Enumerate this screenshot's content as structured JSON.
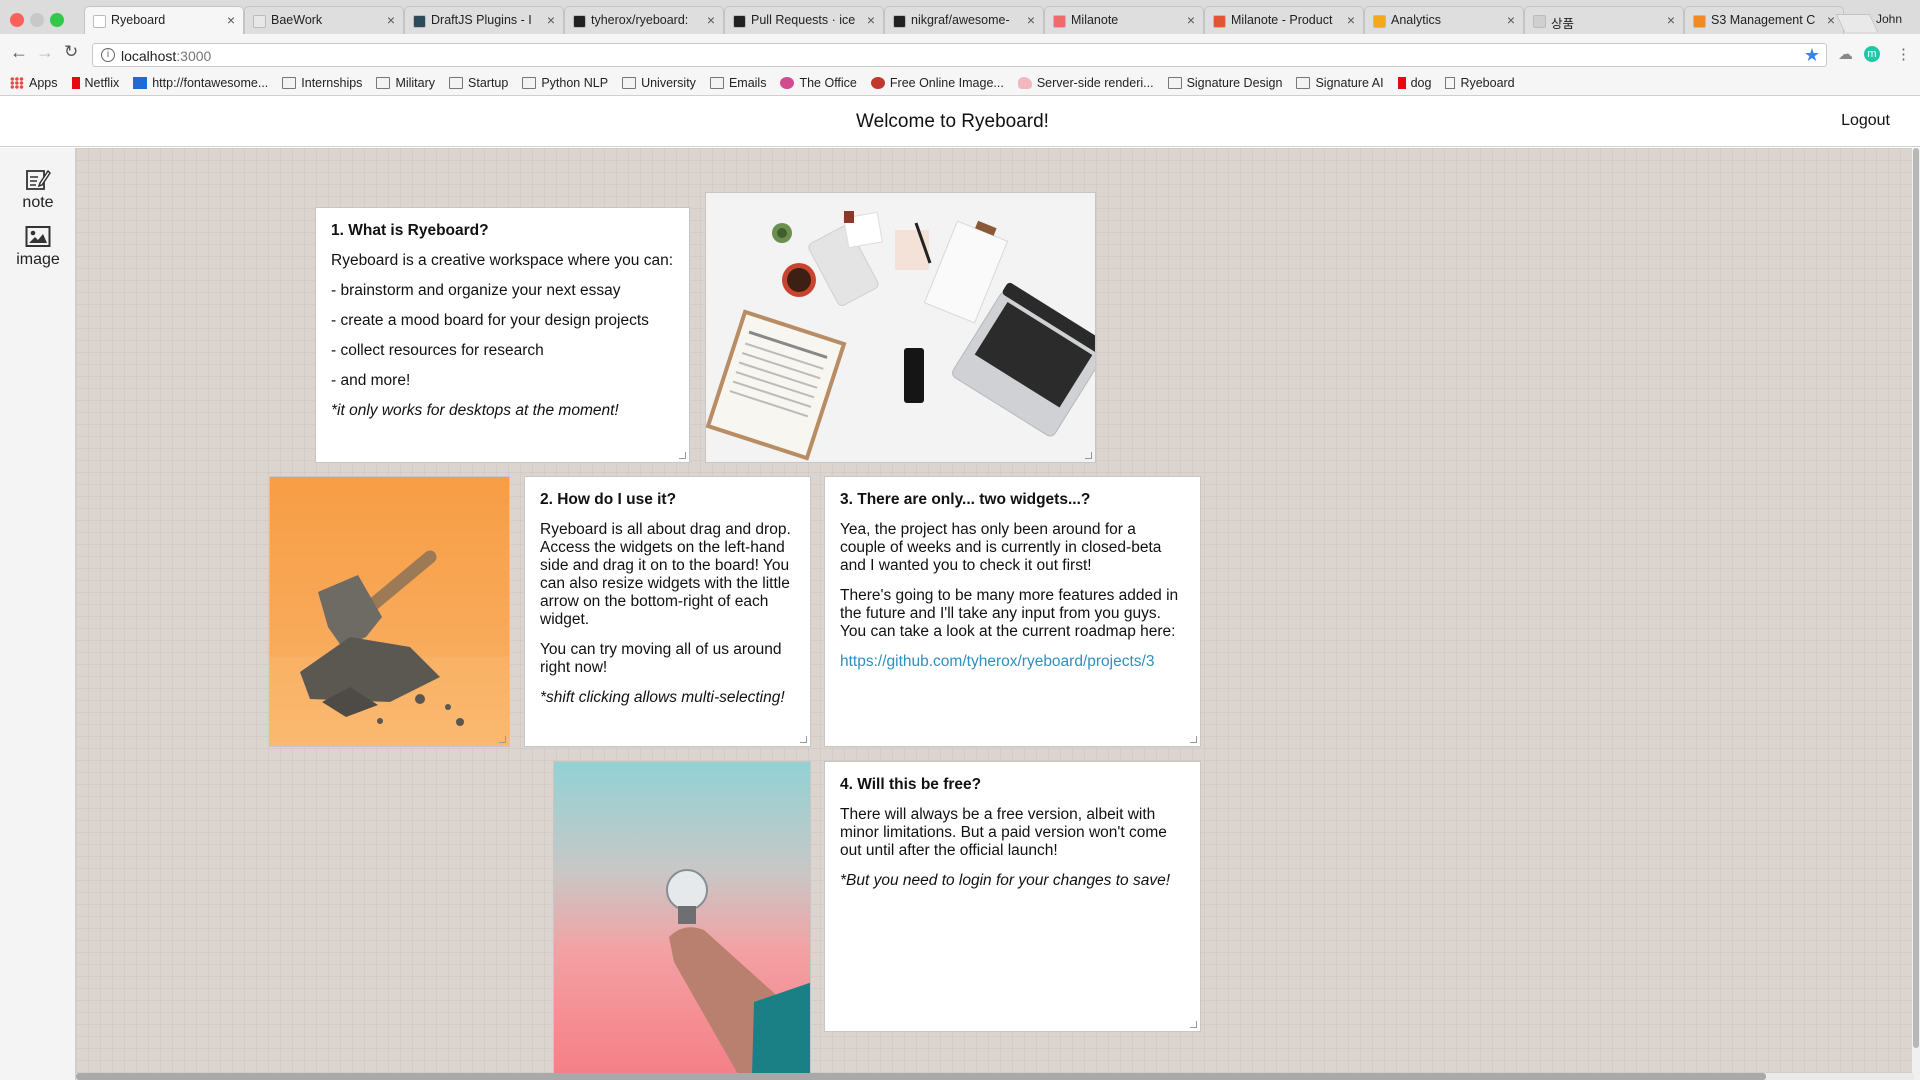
{
  "browser": {
    "tabs": [
      {
        "label": "Ryeboard",
        "active": true,
        "favicon_color": "#ffffff"
      },
      {
        "label": "BaeWork",
        "active": false,
        "favicon_color": "#e8e8e8"
      },
      {
        "label": "DraftJS Plugins - I",
        "active": false,
        "favicon_color": "#2b4a5a"
      },
      {
        "label": "tyherox/ryeboard:",
        "active": false,
        "favicon_color": "#222222"
      },
      {
        "label": "Pull Requests · ice",
        "active": false,
        "favicon_color": "#222222"
      },
      {
        "label": "nikgraf/awesome-",
        "active": false,
        "favicon_color": "#222222"
      },
      {
        "label": "Milanote",
        "active": false,
        "favicon_color": "#ef6a6a"
      },
      {
        "label": "Milanote - Product",
        "active": false,
        "favicon_color": "#e25533"
      },
      {
        "label": "Analytics",
        "active": false,
        "favicon_color": "#f4a91b"
      },
      {
        "label": "상품",
        "active": false,
        "favicon_color": "#cfcfcf"
      },
      {
        "label": "S3 Management C",
        "active": false,
        "favicon_color": "#f08a24"
      }
    ],
    "user": "John",
    "url_host": "localhost",
    "url_port": ":3000",
    "bookmarks": [
      {
        "label": "Apps",
        "icon": "apps-grid-icon"
      },
      {
        "label": "Netflix",
        "icon": "netflix-icon"
      },
      {
        "label": "http://fontawesome...",
        "icon": "flag-icon"
      },
      {
        "label": "Internships",
        "icon": "folder-icon"
      },
      {
        "label": "Military",
        "icon": "folder-icon"
      },
      {
        "label": "Startup",
        "icon": "folder-icon"
      },
      {
        "label": "Python NLP",
        "icon": "folder-icon"
      },
      {
        "label": "University",
        "icon": "folder-icon"
      },
      {
        "label": "Emails",
        "icon": "folder-icon"
      },
      {
        "label": "The Office",
        "icon": "play-icon"
      },
      {
        "label": "Free Online Image...",
        "icon": "globe-icon"
      },
      {
        "label": "Server-side renderi...",
        "icon": "shoe-icon"
      },
      {
        "label": "Signature Design",
        "icon": "folder-icon"
      },
      {
        "label": "Signature AI",
        "icon": "folder-icon"
      },
      {
        "label": "dog",
        "icon": "netflix-icon"
      },
      {
        "label": "Ryeboard",
        "icon": "page-icon"
      }
    ]
  },
  "app": {
    "title": "Welcome to Ryeboard!",
    "logout_label": "Logout",
    "widgets": [
      {
        "label": "note",
        "icon": "note-edit-icon"
      },
      {
        "label": "image",
        "icon": "image-icon"
      }
    ]
  },
  "cards": {
    "card1": {
      "title": "1. What is Ryeboard?",
      "intro": "Ryeboard is a creative workspace where you can:",
      "items": [
        "- brainstorm and organize your next essay",
        "- create a mood board for your design projects",
        "- collect resources for research",
        "- and more!"
      ],
      "note": "*it only works for desktops at the moment!"
    },
    "card2": {
      "title": "2. How do I use it?",
      "p1": "Ryeboard is all about drag and drop. Access the widgets on the left-hand side and drag it on to the board! You can also resize widgets with the little arrow on the bottom-right of each widget.",
      "p2": "You can try moving all of us around right now!",
      "note": "*shift clicking allows multi-selecting!"
    },
    "card3": {
      "title": "3. There are only... two widgets...?",
      "p1": "Yea, the project has only been around for a couple of weeks and is currently in closed-beta and I wanted you to check it out first!",
      "p2": "There's going to be many more features added in the future and I'll take any input from you guys. You can take a look at the current roadmap here:",
      "link": "https://github.com/tyherox/ryeboard/projects/3"
    },
    "card4": {
      "title": "4. Will this be free?",
      "p1": "There will always be a free version, albeit with minor limitations. But a paid version won't come out until after the official launch!",
      "note": "*But you need to login for your changes to save!"
    }
  },
  "images": {
    "desk": "desk-flatlay-image",
    "hammer": "hammer-rock-image",
    "bulb": "hand-lightbulb-image"
  },
  "colors": {
    "board_bg": "#dcd4ce",
    "link": "#2f8fc0",
    "orange_bg": "#f6a653",
    "sky_top": "#93d1d4",
    "sky_bottom": "#f47f86"
  }
}
